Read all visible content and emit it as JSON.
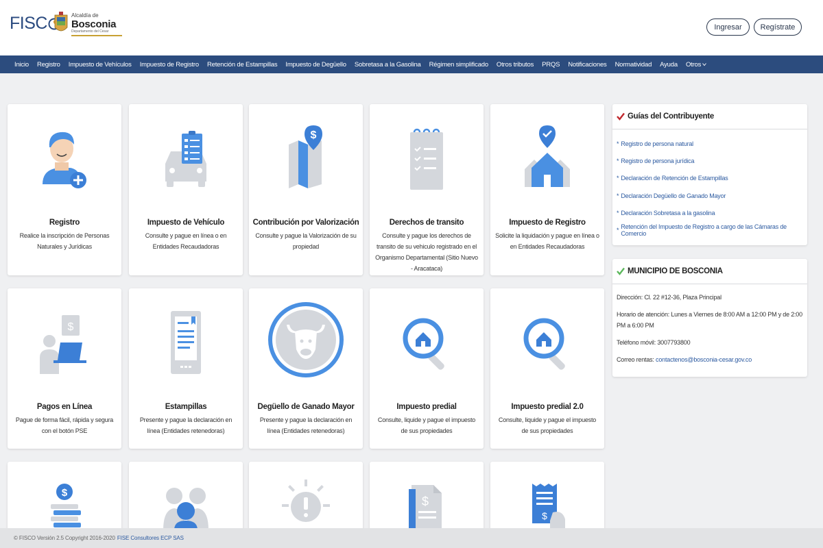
{
  "header": {
    "logo_fisco": "FISC",
    "alcaldia_small": "Alcaldía de",
    "alcaldia_name": "Bosconia",
    "alcaldia_dept": "Departamento del Cesar",
    "btn_login": "Ingresar",
    "btn_register": "Regístrate"
  },
  "nav": {
    "items": [
      "Inicio",
      "Registro",
      "Impuesto de Vehículos",
      "Impuesto de Registro",
      "Retención de Estampillas",
      "Impuesto de Degüello",
      "Sobretasa a la Gasolina",
      "Régimen simplificado",
      "Otros tributos",
      "PRQS",
      "Notificaciones",
      "Normatividad",
      "Ayuda",
      "Otros"
    ]
  },
  "cards": [
    {
      "icon": "user-add-icon",
      "title": "Registro",
      "desc": "Realice la inscripción de Personas Naturales y Jurídicas"
    },
    {
      "icon": "car-clipboard-icon",
      "title": "Impuesto de Vehículo",
      "desc": "Consulte y pague en línea o en Entidades Recaudadoras"
    },
    {
      "icon": "map-dollar-icon",
      "title": "Contribución por Valorización",
      "desc": "Consulte y pague la Valorización de su propiedad"
    },
    {
      "icon": "notepad-checklist-icon",
      "title": "Derechos de transito",
      "desc": "Consulte y pague los derechos de transito de su vehiculo registrado en el Organismo Departamental (Sitio Nuevo - Aracataca)"
    },
    {
      "icon": "houses-pin-icon",
      "title": "Impuesto de Registro",
      "desc": "Solicite la liquidación y pague en línea o en Entidades Recaudadoras"
    },
    {
      "icon": "laptop-payment-icon",
      "title": "Pagos en Línea",
      "desc": "Pague de forma fácil, rápida y segura con el botón PSE"
    },
    {
      "icon": "phone-document-icon",
      "title": "Estampillas",
      "desc": "Presente y pague la declaración en línea (Entidades retenedoras)"
    },
    {
      "icon": "bull-icon",
      "title": "Degüello de Ganado Mayor",
      "desc": "Presente y pague la declaración en línea (Entidades retenedoras)"
    },
    {
      "icon": "house-search-icon",
      "title": "Impuesto predial",
      "desc": "Consulte, liquide y pague el impuesto de sus propiedades"
    },
    {
      "icon": "house-search-icon",
      "title": "Impuesto predial 2.0",
      "desc": "Consulte, liquide y pague el impuesto de sus propiedades"
    },
    {
      "icon": "coins-dollar-icon",
      "title": "",
      "desc": ""
    },
    {
      "icon": "people-icon",
      "title": "",
      "desc": ""
    },
    {
      "icon": "alert-bulb-icon",
      "title": "",
      "desc": ""
    },
    {
      "icon": "invoice-dollar-icon",
      "title": "",
      "desc": ""
    },
    {
      "icon": "receipt-hand-icon",
      "title": "",
      "desc": ""
    }
  ],
  "guides": {
    "title": "Guías del Contribuyente",
    "items": [
      "Registro de persona natural",
      "Registro de persona jurídica",
      "Declaración de Retención de Estampillas",
      "Declaración Degüello de Ganado Mayor",
      "Declaración Sobretasa a la gasolina",
      "Retención del Impuesto de Registro a cargo de las Cámaras de Comercio"
    ]
  },
  "municipio": {
    "title": "MUNICIPIO DE BOSCONIA",
    "direccion": "Dirección: Cl. 22 #12-36, Plaza Principal",
    "horario": "Horario de atención: Lunes a Viernes de 8:00 AM a 12:00 PM y de 2:00 PM a 6:00 PM",
    "telefono": "Teléfono móvil: 3007793800",
    "correo_label": "Correo rentas:",
    "correo": "contactenos@bosconia-cesar.gov.co"
  },
  "footer": {
    "text": "© FISCO Versión 2.5 Copyright 2016-2020",
    "link": "FISE Consultores ECP SAS"
  },
  "colors": {
    "nav_bg": "#2c4c7e",
    "icon_blue": "#4a90e2",
    "icon_gray": "#d4d7dc",
    "check_red": "#c0282d",
    "check_green": "#5cb85c"
  }
}
